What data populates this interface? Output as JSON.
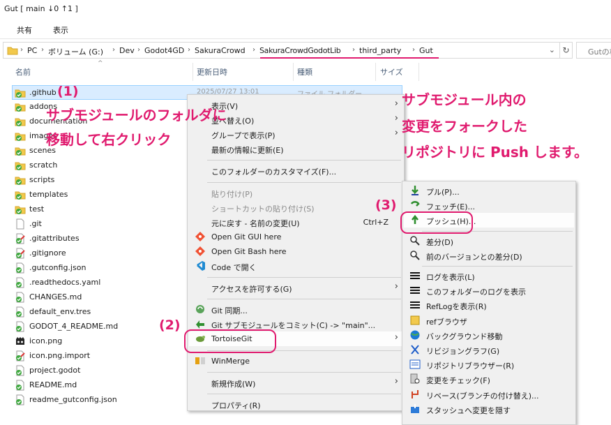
{
  "window": {
    "title": "Gut [ main ↓0 ↑1 ]"
  },
  "ribbon": {
    "tabs": [
      "共有",
      "表示"
    ]
  },
  "address": {
    "crumbs": [
      "PC",
      "ボリューム (G:)",
      "Dev",
      "Godot4GD",
      "SakuraCrowd",
      "SakuraCrowdGodotLib",
      "third_party",
      "Gut"
    ],
    "search_placeholder": "Gutの検"
  },
  "columns": [
    "名前",
    "更新日時",
    "種類",
    "サイズ"
  ],
  "files": [
    {
      "name": ".github",
      "icon": "folder-git-icon",
      "date": "2025/07/27 13:01",
      "type": "ファイル フォルダー"
    },
    {
      "name": "addons",
      "icon": "folder-git-icon"
    },
    {
      "name": "documentation",
      "icon": "folder-git-icon"
    },
    {
      "name": "images",
      "icon": "folder-git-icon"
    },
    {
      "name": "scenes",
      "icon": "folder-git-icon"
    },
    {
      "name": "scratch",
      "icon": "folder-git-icon"
    },
    {
      "name": "scripts",
      "icon": "folder-git-icon"
    },
    {
      "name": "templates",
      "icon": "folder-git-icon"
    },
    {
      "name": "test",
      "icon": "folder-git-icon"
    },
    {
      "name": ".git",
      "icon": "file-icon"
    },
    {
      "name": ".gitattributes",
      "icon": "file-git-modified-icon"
    },
    {
      "name": ".gitignore",
      "icon": "file-git-modified-icon"
    },
    {
      "name": ".gutconfig.json",
      "icon": "file-git-icon"
    },
    {
      "name": ".readthedocs.yaml",
      "icon": "file-git-icon"
    },
    {
      "name": "CHANGES.md",
      "icon": "file-git-icon"
    },
    {
      "name": "default_env.tres",
      "icon": "file-git-icon"
    },
    {
      "name": "GODOT_4_README.md",
      "icon": "file-git-icon"
    },
    {
      "name": "icon.png",
      "icon": "godot-icon"
    },
    {
      "name": "icon.png.import",
      "icon": "file-git-modified-icon"
    },
    {
      "name": "project.godot",
      "icon": "file-git-icon"
    },
    {
      "name": "README.md",
      "icon": "file-git-icon"
    },
    {
      "name": "readme_gutconfig.json",
      "icon": "file-git-icon"
    }
  ],
  "context_menu": {
    "items": [
      {
        "label": "表示(V)",
        "submenu": true
      },
      {
        "label": "並べ替え(O)",
        "submenu": true
      },
      {
        "label": "グループで表示(P)",
        "submenu": true
      },
      {
        "label": "最新の情報に更新(E)"
      },
      {
        "sep": true
      },
      {
        "label": "このフォルダーのカスタマイズ(F)..."
      },
      {
        "sep": true
      },
      {
        "label": "貼り付け(P)",
        "disabled": true
      },
      {
        "label": "ショートカットの貼り付け(S)",
        "disabled": true
      },
      {
        "label": "元に戻す - 名前の変更(U)",
        "shortcut": "Ctrl+Z"
      },
      {
        "label": "Open Git GUI here",
        "icon": "git-gui-icon"
      },
      {
        "label": "Open Git Bash here",
        "icon": "git-bash-icon"
      },
      {
        "label": "Code で開く",
        "icon": "vscode-icon"
      },
      {
        "sep": true
      },
      {
        "label": "アクセスを許可する(G)",
        "submenu": true
      },
      {
        "sep": true
      },
      {
        "label": "Git 同期...",
        "icon": "git-sync-icon"
      },
      {
        "label": "Git サブモジュールをコミット(C) -> \"main\"...",
        "icon": "git-commit-icon"
      },
      {
        "label": "TortoiseGit",
        "icon": "tortoisegit-icon",
        "submenu": true,
        "highlighted": true
      },
      {
        "sep": true
      },
      {
        "label": "WinMerge",
        "icon": "winmerge-icon"
      },
      {
        "sep": true
      },
      {
        "label": "新規作成(W)",
        "submenu": true
      },
      {
        "sep": true
      },
      {
        "label": "プロパティ(R)"
      }
    ]
  },
  "tortoise_menu": {
    "items": [
      {
        "label": "プル(P)...",
        "icon": "pull-icon"
      },
      {
        "label": "フェッチ(E)...",
        "icon": "fetch-icon"
      },
      {
        "label": "プッシュ(H)...",
        "icon": "push-icon",
        "highlighted": true
      },
      {
        "sep": true
      },
      {
        "label": "差分(D)",
        "icon": "diff-icon"
      },
      {
        "label": "前のバージョンとの差分(D)",
        "icon": "diff-prev-icon"
      },
      {
        "sep": true
      },
      {
        "label": "ログを表示(L)",
        "icon": "log-icon"
      },
      {
        "label": "このフォルダーのログを表示",
        "icon": "log-folder-icon"
      },
      {
        "label": "RefLogを表示(R)",
        "icon": "reflog-icon"
      },
      {
        "label": "refブラウザ",
        "icon": "ref-browser-icon"
      },
      {
        "label": "バックグラウンド移動",
        "icon": "globe-icon"
      },
      {
        "label": "リビジョングラフ(G)",
        "icon": "revision-graph-icon"
      },
      {
        "label": "リポジトリブラウザー(R)",
        "icon": "repo-browser-icon"
      },
      {
        "label": "変更をチェック(F)",
        "icon": "check-changes-icon"
      },
      {
        "label": "リベース(ブランチの付け替え)...",
        "icon": "rebase-icon"
      },
      {
        "label": "スタッシュへ変更を隠す",
        "icon": "stash-icon"
      }
    ]
  },
  "annotations": {
    "step1": "(1)",
    "step1_text_line1": "サブモジュールのフォルダに",
    "step1_text_line2": "移動して右クリック",
    "step2": "(2)",
    "step3": "(3)",
    "right_line1": "サブモジュール内の",
    "right_line2": "変更をフォークした",
    "right_line3": "リポジトリに Push します。",
    "color": "#e01a6e"
  }
}
